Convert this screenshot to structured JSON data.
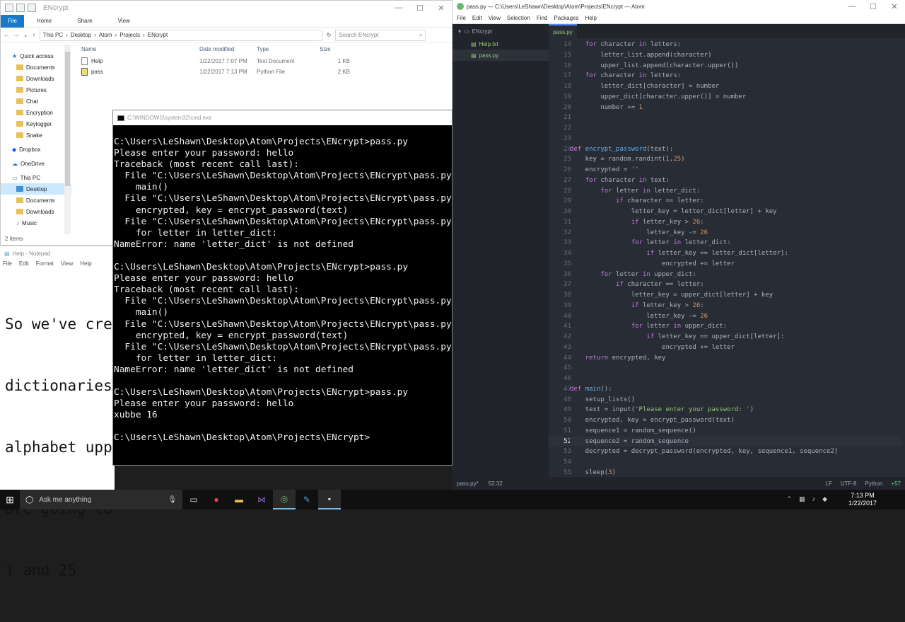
{
  "explorer": {
    "title": "ENcrypt",
    "ribbon": [
      "File",
      "Home",
      "Share",
      "View"
    ],
    "breadcrumb": [
      "This PC",
      "Desktop",
      "Atom",
      "Projects",
      "ENcrypt"
    ],
    "search_placeholder": "Search ENcrypt",
    "columns": [
      "Name",
      "Date modified",
      "Type",
      "Size"
    ],
    "files": [
      {
        "name": "Help",
        "date": "1/22/2017 7:07 PM",
        "type": "Text Document",
        "size": "1 KB"
      },
      {
        "name": "pass",
        "date": "1/22/2017 7:13 PM",
        "type": "Python File",
        "size": "2 KB"
      }
    ],
    "nav": [
      "Quick access",
      "Documents",
      "Downloads",
      "Pictures",
      "Chat",
      "Encryption",
      "Keylogger",
      "Snake",
      "Dropbox",
      "OneDrive",
      "This PC",
      "Desktop",
      "Documents",
      "Downloads",
      "Music"
    ],
    "status": "2 items"
  },
  "notepad": {
    "title": "Help - Notepad",
    "menu": [
      "File",
      "Edit",
      "Format",
      "View",
      "Help"
    ],
    "lines": [
      "So we've cre",
      "dictionaries",
      "alphabet upp",
      "are going to",
      "1 and 25"
    ]
  },
  "cmd": {
    "title": "C:\\WINDOWS\\system32\\cmd.exe",
    "lines": [
      "C:\\Users\\LeShawn\\Desktop\\Atom\\Projects\\ENcrypt>pass.py",
      "Please enter your password: hello",
      "Traceback (most recent call last):",
      "  File \"C:\\Users\\LeShawn\\Desktop\\Atom\\Projects\\ENcrypt\\pass.py\", l",
      "    main()",
      "  File \"C:\\Users\\LeShawn\\Desktop\\Atom\\Projects\\ENcrypt\\pass.py\", l",
      "    encrypted, key = encrypt_password(text)",
      "  File \"C:\\Users\\LeShawn\\Desktop\\Atom\\Projects\\ENcrypt\\pass.py\", l",
      "    for letter in letter_dict:",
      "NameError: name 'letter_dict' is not defined",
      "",
      "C:\\Users\\LeShawn\\Desktop\\Atom\\Projects\\ENcrypt>pass.py",
      "Please enter your password: hello",
      "Traceback (most recent call last):",
      "  File \"C:\\Users\\LeShawn\\Desktop\\Atom\\Projects\\ENcrypt\\pass.py\", l",
      "    main()",
      "  File \"C:\\Users\\LeShawn\\Desktop\\Atom\\Projects\\ENcrypt\\pass.py\", l",
      "    encrypted, key = encrypt_password(text)",
      "  File \"C:\\Users\\LeShawn\\Desktop\\Atom\\Projects\\ENcrypt\\pass.py\", l",
      "    for letter in letter_dict:",
      "NameError: name 'letter_dict' is not defined",
      "",
      "C:\\Users\\LeShawn\\Desktop\\Atom\\Projects\\ENcrypt>pass.py",
      "Please enter your password: hello",
      "xubbe 16",
      "",
      "C:\\Users\\LeShawn\\Desktop\\Atom\\Projects\\ENcrypt>"
    ]
  },
  "atom": {
    "title": "pass.py — C:\\Users\\LeShawn\\Desktop\\Atom\\Projects\\ENcrypt — Atom",
    "menu": [
      "File",
      "Edit",
      "View",
      "Selection",
      "Find",
      "Packages",
      "Help"
    ],
    "project": "ENcrypt",
    "tree_files": [
      "Help.txt",
      "pass.py"
    ],
    "tab": "pass.py",
    "first_line": 14,
    "current_line": 52,
    "code": [
      "    for character in letters:",
      "        letter_list.append(character)",
      "        upper_list.append(character.upper())",
      "    for character in letters:",
      "        letter_dict[character] = number",
      "        upper_dict[character.upper()] = number",
      "        number += 1",
      "",
      "",
      "",
      "def encrypt_password(text):",
      "    key = random.randint(1,25)",
      "    encrypted = ''",
      "    for character in text:",
      "        for letter in letter_dict:",
      "            if character == letter:",
      "                letter_key = letter_dict[letter] + key",
      "                if letter_key > 26:",
      "                    letter_key -= 26",
      "                for letter in letter_dict:",
      "                    if letter_key == letter_dict[letter]:",
      "                        encrypted += letter",
      "        for letter in upper_dict:",
      "            if character == letter:",
      "                letter_key = upper_dict[letter] + key",
      "                if letter_key > 26:",
      "                    letter_key -= 26",
      "                for letter in upper_dict:",
      "                    if letter_key == upper_dict[letter]:",
      "                        encrypted += letter",
      "    return encrypted, key",
      "",
      "",
      "def main():",
      "    setup_lists()",
      "    text = input('Please enter your password: ')",
      "    encrypted, key = encrypt_password(text)",
      "    sequence1 = random_sequence()",
      "    sequence2 = random_sequence",
      "    decrypted = decrypt_password(encrypted, key, sequence1, sequence2)",
      "",
      "    sleep(3)"
    ],
    "status_left": "pass.py*",
    "status_pos": "52:32",
    "status_right": [
      "LF",
      "UTF-8",
      "Python",
      "+57"
    ]
  },
  "taskbar": {
    "search": "Ask me anything",
    "time": "7:13 PM",
    "date": "1/22/2017"
  }
}
